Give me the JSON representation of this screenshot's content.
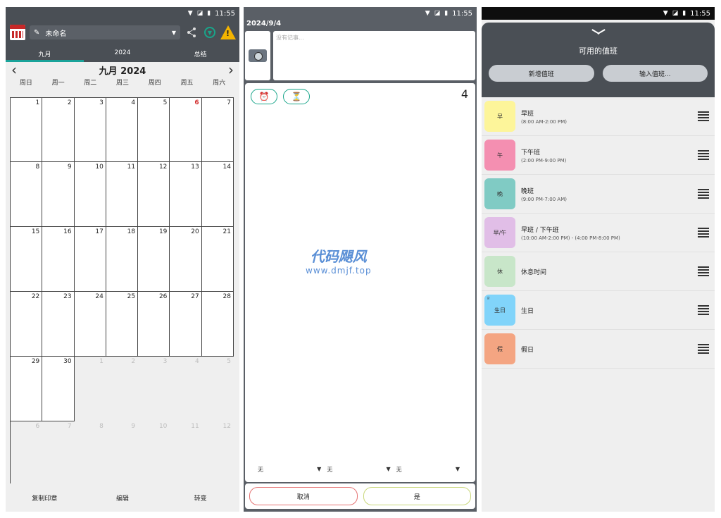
{
  "status": {
    "time": "11:55"
  },
  "screen1": {
    "name_value": "未命名",
    "tabs": [
      "九月",
      "2024",
      "总结"
    ],
    "month_title": "九月 2024",
    "weekdays": [
      "周日",
      "周一",
      "周二",
      "周三",
      "周四",
      "周五",
      "周六"
    ],
    "weeks": [
      [
        "1",
        "2",
        "3",
        "4",
        "5",
        "6",
        "7"
      ],
      [
        "8",
        "9",
        "10",
        "11",
        "12",
        "13",
        "14"
      ],
      [
        "15",
        "16",
        "17",
        "18",
        "19",
        "20",
        "21"
      ],
      [
        "22",
        "23",
        "24",
        "25",
        "26",
        "27",
        "28"
      ],
      [
        "29",
        "30",
        "1",
        "2",
        "3",
        "4",
        "5"
      ],
      [
        "6",
        "7",
        "8",
        "9",
        "10",
        "11",
        "12"
      ]
    ],
    "bottom_actions": [
      "复制印章",
      "编辑",
      "转变"
    ],
    "colors": {
      "header": "#4a4f55",
      "accent": "#1aa39a",
      "today": "#d32f2f"
    }
  },
  "screen2": {
    "date": "2024/9/4",
    "note_placeholder": "没有记事...",
    "day_number": "4",
    "dropdowns": [
      "无",
      "无",
      "无"
    ],
    "watermark_title": "代码飓风",
    "watermark_url": "www.dmjf.top",
    "cancel": "取消",
    "yes": "是"
  },
  "screen3": {
    "title": "可用的值班",
    "add_shift": "新增值班",
    "input_shift": "输入值班...",
    "shifts": [
      {
        "badge": "早",
        "name": "早班",
        "time": "(8:00 AM-2:00 PM)",
        "color": "#fdf59a"
      },
      {
        "badge": "午",
        "name": "下午班",
        "time": "(2:00 PM-9:00 PM)",
        "color": "#f48fb1"
      },
      {
        "badge": "晚",
        "name": "晚班",
        "time": "(9:00 PM-7:00 AM)",
        "color": "#80cbc4"
      },
      {
        "badge": "早/午",
        "name": "早班 / 下午班",
        "time": "(10:00 AM-2:00 PM) - (4:00 PM-8:00 PM)",
        "color": "#e1bee7"
      },
      {
        "badge": "休",
        "name": "休息时间",
        "time": "",
        "color": "#c8e6c9"
      },
      {
        "badge": "生日",
        "name": "生日",
        "time": "",
        "color": "#81d4fa"
      },
      {
        "badge": "假",
        "name": "假日",
        "time": "",
        "color": "#f4a582"
      }
    ]
  }
}
